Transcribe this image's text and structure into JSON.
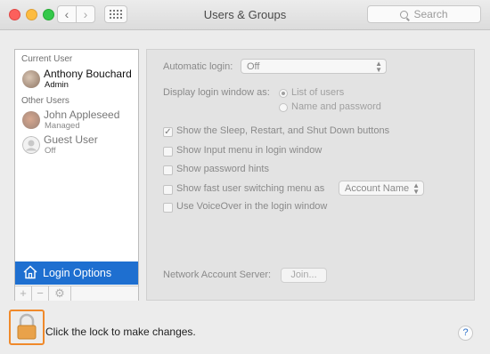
{
  "window": {
    "title": "Users & Groups"
  },
  "toolbar": {
    "back_glyph": "‹",
    "forward_glyph": "›",
    "search_placeholder": "Search"
  },
  "sidebar": {
    "current_user_heading": "Current User",
    "current_user": {
      "name": "Anthony Bouchard",
      "role": "Admin"
    },
    "other_users_heading": "Other Users",
    "other_users": [
      {
        "name": "John Appleseed",
        "role": "Managed"
      },
      {
        "name": "Guest User",
        "role": "Off"
      }
    ],
    "login_options_label": "Login Options",
    "add_glyph": "+",
    "remove_glyph": "−",
    "gear_glyph": "⚙"
  },
  "main": {
    "automatic_login_label": "Automatic login:",
    "automatic_login_value": "Off",
    "display_login_label": "Display login window as:",
    "display_options": [
      "List of users",
      "Name and password"
    ],
    "display_selected": "List of users",
    "checkboxes": [
      {
        "label": "Show the Sleep, Restart, and Shut Down buttons",
        "checked": true
      },
      {
        "label": "Show Input menu in login window",
        "checked": false
      },
      {
        "label": "Show password hints",
        "checked": false
      },
      {
        "label": "Show fast user switching menu as",
        "checked": false
      },
      {
        "label": "Use VoiceOver in the login window",
        "checked": false
      }
    ],
    "fast_switch_value": "Account Name",
    "network_server_label": "Network Account Server:",
    "join_label": "Join...",
    "check_glyph": "✓"
  },
  "footer": {
    "lock_message": "Click the lock to make changes.",
    "help_glyph": "?"
  },
  "colors": {
    "selection": "#1e6fd0",
    "lock_highlight": "#f0892a",
    "lock_body": "#e9a24a"
  }
}
